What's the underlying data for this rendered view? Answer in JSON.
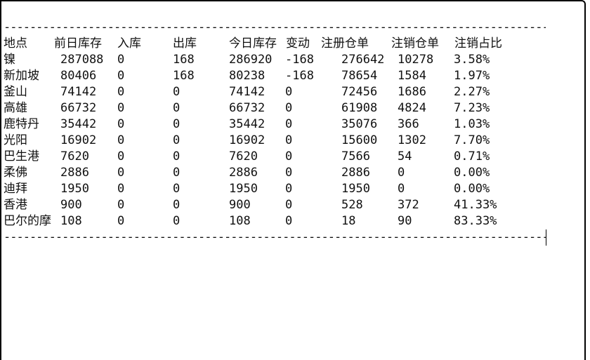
{
  "console": {
    "rule_text": "-------------------------------------------------------------------------------------------------------------------------------",
    "headers": [
      "地点",
      "前日库存",
      "入库",
      "出库",
      "今日库存",
      "变动",
      "注册仓单",
      "注销仓单",
      "注销占比"
    ],
    "rows": [
      [
        "镍",
        "287088",
        "0",
        "168",
        "286920",
        "-168",
        "276642",
        "10278",
        "3.58%"
      ],
      [
        "新加坡",
        "80406",
        "0",
        "168",
        "80238",
        "-168",
        "78654",
        "1584",
        "1.97%"
      ],
      [
        "釜山",
        "74142",
        "0",
        "0",
        "74142",
        "0",
        "72456",
        "1686",
        "2.27%"
      ],
      [
        "高雄",
        "66732",
        "0",
        "0",
        "66732",
        "0",
        "61908",
        "4824",
        "7.23%"
      ],
      [
        "鹿特丹",
        "35442",
        "0",
        "0",
        "35442",
        "0",
        "35076",
        "366",
        "1.03%"
      ],
      [
        "光阳",
        "16902",
        "0",
        "0",
        "16902",
        "0",
        "15600",
        "1302",
        "7.70%"
      ],
      [
        "巴生港",
        "7620",
        "0",
        "0",
        "7620",
        "0",
        "7566",
        "54",
        "0.71%"
      ],
      [
        "柔佛",
        "2886",
        "0",
        "0",
        "2886",
        "0",
        "2886",
        "0",
        "0.00%"
      ],
      [
        "迪拜",
        "1950",
        "0",
        "0",
        "1950",
        "0",
        "1950",
        "0",
        "0.00%"
      ],
      [
        "香港",
        "900",
        "0",
        "0",
        "900",
        "0",
        "528",
        "372",
        "41.33%"
      ],
      [
        "巴尔的摩",
        "108",
        "0",
        "0",
        "108",
        "0",
        "18",
        "90",
        "83.33%"
      ]
    ]
  }
}
